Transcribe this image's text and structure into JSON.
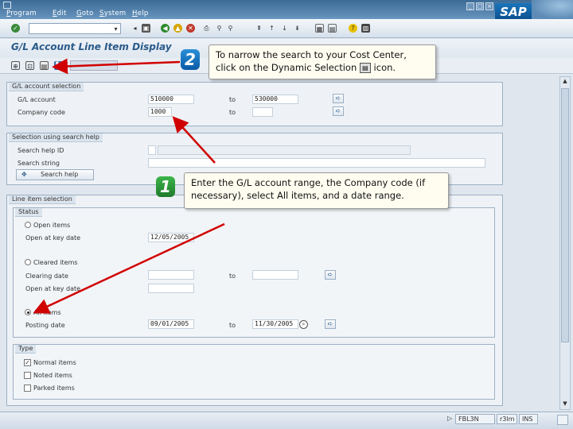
{
  "menu": [
    "Program",
    "Edit",
    "Goto",
    "System",
    "Help"
  ],
  "brand": "SAP",
  "screen_title": "G/L Account Line Item Display",
  "frames": {
    "gl_selection": {
      "title": "G/L account selection",
      "gl_account_label": "G/L account",
      "gl_account_from": "510000",
      "to_label": "to",
      "gl_account_to": "530000",
      "company_code_label": "Company code",
      "company_code_value": "1000",
      "company_code_to_label": "to"
    },
    "search_help": {
      "title": "Selection using search help",
      "search_help_id_label": "Search help ID",
      "search_string_label": "Search string",
      "button_label": "Search help"
    },
    "line_item": {
      "title": "Line item selection",
      "status_title": "Status",
      "open_items_label": "Open items",
      "open_at_key_date_label": "Open at key date",
      "open_at_key_date_value": "12/05/2005",
      "cleared_items_label": "Cleared items",
      "clearing_date_label": "Clearing date",
      "clearing_to_label": "to",
      "open_at_key_date2_label": "Open at key date",
      "all_items_label": "All items",
      "posting_date_label": "Posting date",
      "posting_date_from": "09/01/2005",
      "posting_to_label": "to",
      "posting_date_to": "11/30/2005",
      "type_title": "Type",
      "normal_items_label": "Normal items",
      "noted_items_label": "Noted items",
      "parked_items_label": "Parked items"
    }
  },
  "callouts": {
    "step2_number": "2",
    "step2_text_a": "To narrow the search to your Cost Center,",
    "step2_text_b": "click on the Dynamic Selection",
    "step2_text_c": "icon.",
    "step1_number": "1",
    "step1_text": "Enter the G/L account range, the Company code (if necessary), select All items, and a date range."
  },
  "status_bar": {
    "transaction": "FBL3N",
    "server": "r3lm",
    "mode": "INS"
  }
}
